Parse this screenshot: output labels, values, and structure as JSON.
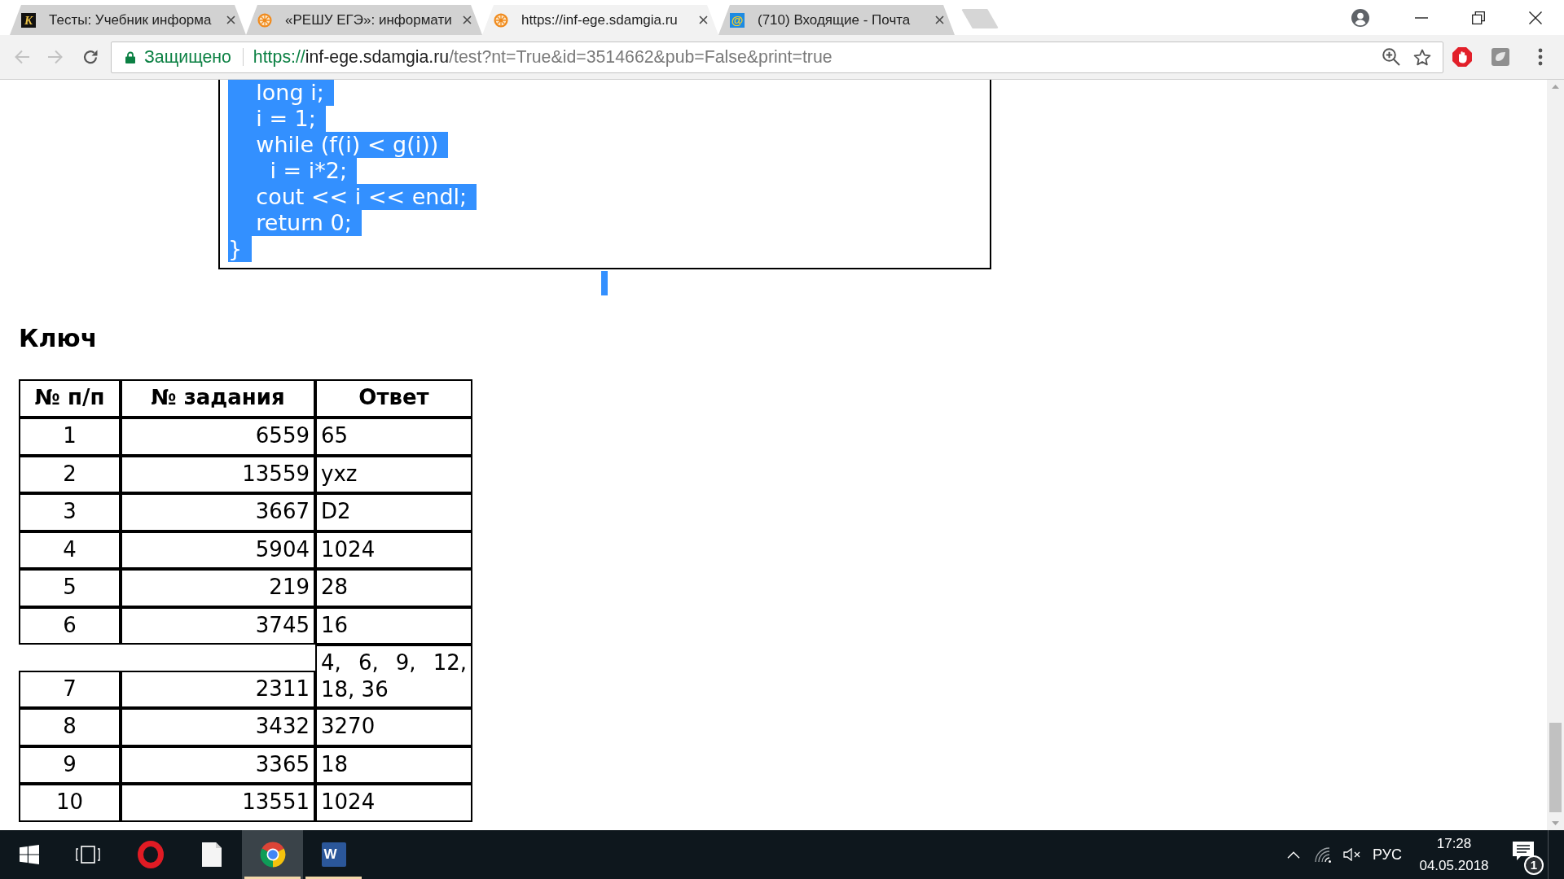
{
  "browser": {
    "tabs": [
      {
        "kind": "letter",
        "favicon_text": "K",
        "title": "Тесты: Учебник информа",
        "selected": false
      },
      {
        "kind": "wheel",
        "title": "«РЕШУ ЕГЭ»: информати",
        "selected": false
      },
      {
        "kind": "wheel",
        "title": "https://inf-ege.sdamgia.ru",
        "selected": true
      },
      {
        "kind": "mail",
        "favicon_text": "@",
        "title": "(710) Входящие - Почта",
        "selected": false
      }
    ],
    "toolbar": {
      "back": {
        "disabled": true
      },
      "forward": {
        "disabled": true
      },
      "security_label": "Защищено",
      "url": {
        "scheme": "https://",
        "host": "inf-ege.sdamgia.ru",
        "path": "/test?nt=True&id=3514662&pub=False&print=true"
      }
    }
  },
  "page": {
    "code": {
      "selected": true,
      "lines": [
        "    long i;",
        "    i = 1;",
        "    while (f(i) < g(i))",
        "      i = i*2;",
        "    cout << i << endl;",
        "    return 0;",
        "}"
      ]
    },
    "heading": "Ключ",
    "table": {
      "columns": [
        "№ п/п",
        "№ задания",
        "Ответ"
      ],
      "rows": [
        [
          "1",
          "6559",
          "65"
        ],
        [
          "2",
          "13559",
          "yxz"
        ],
        [
          "3",
          "3667",
          "D2"
        ],
        [
          "4",
          "5904",
          "1024"
        ],
        [
          "5",
          "219",
          "28"
        ],
        [
          "6",
          "3745",
          "16"
        ],
        [
          "7",
          "2311",
          "4, 6, 9, 12, 18, 36"
        ],
        [
          "8",
          "3432",
          "3270"
        ],
        [
          "9",
          "3365",
          "18"
        ],
        [
          "10",
          "13551",
          "1024"
        ]
      ]
    }
  },
  "taskbar": {
    "apps": [
      {
        "kind": "ring",
        "selected": false,
        "running": false
      },
      {
        "kind": "page",
        "selected": false,
        "running": false
      },
      {
        "kind": "circle",
        "selected": true,
        "running": true
      },
      {
        "kind": "tile",
        "label": "W",
        "selected": false,
        "running": true
      }
    ],
    "tray": {
      "language": "РУС",
      "time": "17:28",
      "date": "04.05.2018",
      "notification_count": "1"
    }
  }
}
